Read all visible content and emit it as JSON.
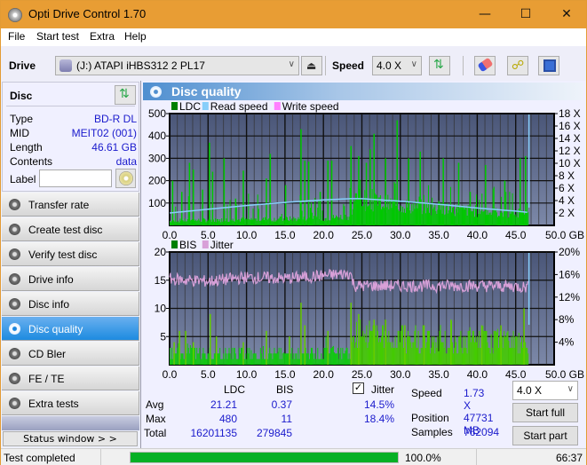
{
  "window": {
    "title": "Opti Drive Control 1.70",
    "minimize_icon": "minimize-icon",
    "maximize_icon": "maximize-icon",
    "close_icon": "close-icon"
  },
  "menu": [
    "File",
    "Start test",
    "Extra",
    "Help"
  ],
  "toolbar": {
    "drive_label": "Drive",
    "drive_value": "(J:)  ATAPI iHBS312  2 PL17",
    "speed_label": "Speed",
    "speed_value": "4.0 X",
    "icons": [
      "eject-icon",
      "refresh-icon",
      "eraser-icon",
      "chain-icon",
      "save-icon"
    ]
  },
  "disc": {
    "header": "Disc",
    "rows": [
      {
        "label": "Type",
        "value": "BD-R DL"
      },
      {
        "label": "MID",
        "value": "MEIT02 (001)"
      },
      {
        "label": "Length",
        "value": "46.61 GB"
      },
      {
        "label": "Contents",
        "value": "data"
      }
    ],
    "label_field_label": "Label",
    "label_field_value": ""
  },
  "nav": [
    {
      "label": "Transfer rate",
      "active": false
    },
    {
      "label": "Create test disc",
      "active": false
    },
    {
      "label": "Verify test disc",
      "active": false
    },
    {
      "label": "Drive info",
      "active": false
    },
    {
      "label": "Disc info",
      "active": false
    },
    {
      "label": "Disc quality",
      "active": true
    },
    {
      "label": "CD Bler",
      "active": false
    },
    {
      "label": "FE / TE",
      "active": false
    },
    {
      "label": "Extra tests",
      "active": false
    }
  ],
  "status_window_label": "Status window > >",
  "panel_title": "Disc quality",
  "colors": {
    "ldc": "#00c800",
    "bis": "#00c800",
    "read_speed": "#87cefa",
    "write_speed": "#ff80ff",
    "jitter": "#d8a0d8",
    "plot_bg_top": "#4a5678",
    "plot_bg_bottom": "#7c88a8"
  },
  "chart_data": [
    {
      "type": "bar",
      "title": "LDC / Read speed",
      "legend": [
        "LDC",
        "Read speed",
        "Write speed"
      ],
      "legend_position": "top-left",
      "xlabel": "GB",
      "x_ticks": [
        "0.0",
        "5.0",
        "10.0",
        "15.0",
        "20.0",
        "25.0",
        "30.0",
        "35.0",
        "40.0",
        "45.0",
        "50.0 GB"
      ],
      "xlim": [
        0,
        50
      ],
      "y_ticks_left": [
        "100",
        "200",
        "300",
        "400",
        "500"
      ],
      "ylim_left": [
        0,
        500
      ],
      "y_ticks_right": [
        "2 X",
        "4 X",
        "6 X",
        "8 X",
        "10 X",
        "12 X",
        "14 X",
        "16 X",
        "18 X"
      ],
      "ylim_right": [
        0,
        18
      ],
      "grid": true,
      "data_end_gb": 46.61,
      "ldc_peaks": [
        [
          0.3,
          200
        ],
        [
          1.5,
          150
        ],
        [
          2.5,
          280
        ],
        [
          3.0,
          250
        ],
        [
          4.2,
          160
        ],
        [
          5.1,
          370
        ],
        [
          5.5,
          240
        ],
        [
          7.0,
          300
        ],
        [
          8.5,
          120
        ],
        [
          9.5,
          245
        ],
        [
          12.5,
          210
        ],
        [
          13.0,
          320
        ],
        [
          15.0,
          180
        ],
        [
          17.0,
          430
        ],
        [
          17.5,
          290
        ],
        [
          18.0,
          285
        ],
        [
          19.5,
          150
        ],
        [
          20.5,
          290
        ],
        [
          21.0,
          290
        ],
        [
          23.5,
          355
        ],
        [
          24.5,
          310
        ],
        [
          25.5,
          280
        ],
        [
          26.0,
          340
        ],
        [
          26.5,
          410
        ],
        [
          28.0,
          300
        ],
        [
          29.5,
          470
        ],
        [
          31.0,
          300
        ],
        [
          32.5,
          330
        ],
        [
          35.5,
          300
        ],
        [
          37.5,
          280
        ],
        [
          39.0,
          150
        ],
        [
          41.0,
          270
        ],
        [
          43.5,
          200
        ],
        [
          45.5,
          300
        ],
        [
          46.2,
          310
        ]
      ],
      "ldc_baseline": [
        [
          0,
          20
        ],
        [
          10,
          25
        ],
        [
          20,
          30
        ],
        [
          23.5,
          40
        ],
        [
          24,
          110
        ],
        [
          30,
          85
        ],
        [
          40,
          60
        ],
        [
          46.6,
          45
        ]
      ],
      "read_speed_x": [
        [
          0,
          2.0
        ],
        [
          5,
          2.6
        ],
        [
          10,
          3.2
        ],
        [
          15,
          3.7
        ],
        [
          20,
          4.1
        ],
        [
          23.5,
          4.3
        ],
        [
          25,
          4.3
        ],
        [
          30,
          3.9
        ],
        [
          35,
          3.4
        ],
        [
          40,
          2.8
        ],
        [
          45,
          2.3
        ],
        [
          46.6,
          2.1
        ]
      ]
    },
    {
      "type": "bar",
      "title": "BIS / Jitter",
      "legend": [
        "BIS",
        "Jitter"
      ],
      "legend_position": "top-left",
      "xlabel": "GB",
      "x_ticks": [
        "0.0",
        "5.0",
        "10.0",
        "15.0",
        "20.0",
        "25.0",
        "30.0",
        "35.0",
        "40.0",
        "45.0",
        "50.0 GB"
      ],
      "xlim": [
        0,
        50
      ],
      "y_ticks_left": [
        "5",
        "10",
        "15",
        "20"
      ],
      "ylim_left": [
        0,
        20
      ],
      "y_ticks_right": [
        "4%",
        "8%",
        "12%",
        "16%",
        "20%"
      ],
      "ylim_right": [
        0,
        20
      ],
      "grid": true,
      "data_end_gb": 46.61,
      "bis_peaks": [
        [
          0.5,
          4
        ],
        [
          1.2,
          6
        ],
        [
          2.0,
          6
        ],
        [
          3.0,
          4
        ],
        [
          5.2,
          9
        ],
        [
          6.0,
          5
        ],
        [
          9.5,
          4
        ],
        [
          12.5,
          6
        ],
        [
          15.5,
          5
        ],
        [
          17.0,
          11
        ],
        [
          17.5,
          7
        ],
        [
          20.5,
          6
        ],
        [
          23.5,
          11
        ],
        [
          24.5,
          9
        ],
        [
          26.5,
          8
        ],
        [
          28.0,
          8
        ],
        [
          30.5,
          7
        ],
        [
          33.0,
          7
        ],
        [
          36.5,
          8
        ],
        [
          40.5,
          7
        ],
        [
          43.0,
          7
        ],
        [
          46.0,
          10
        ]
      ],
      "bis_baseline": [
        [
          0,
          2
        ],
        [
          23.5,
          2
        ],
        [
          24,
          5
        ],
        [
          46.6,
          4
        ]
      ],
      "jitter_percent": [
        [
          0,
          15.2
        ],
        [
          5,
          14.8
        ],
        [
          10,
          15.5
        ],
        [
          15,
          15.3
        ],
        [
          20,
          15.8
        ],
        [
          23.5,
          16.2
        ],
        [
          24,
          14.0
        ],
        [
          30,
          14.0
        ],
        [
          35,
          14.0
        ],
        [
          40,
          14.0
        ],
        [
          45,
          13.9
        ],
        [
          46.6,
          13.8
        ]
      ]
    }
  ],
  "stats": {
    "col_headers": [
      "LDC",
      "BIS"
    ],
    "rows": [
      {
        "label": "Avg",
        "ldc": "21.21",
        "bis": "0.37",
        "jitter": "14.5%"
      },
      {
        "label": "Max",
        "ldc": "480",
        "bis": "11",
        "jitter": "18.4%"
      },
      {
        "label": "Total",
        "ldc": "16201135",
        "bis": "279845",
        "jitter": ""
      }
    ],
    "jitter_label": "Jitter",
    "jitter_checked": true,
    "speed_label": "Speed",
    "speed_value": "1.73 X",
    "position_label": "Position",
    "position_value": "47731 MB",
    "samples_label": "Samples",
    "samples_value": "762094",
    "speed_select": "4.0 X",
    "start_full": "Start full",
    "start_part": "Start part"
  },
  "statusbar": {
    "text": "Test completed",
    "progress": 100.0,
    "progress_text": "100.0%",
    "time": "66:37"
  }
}
